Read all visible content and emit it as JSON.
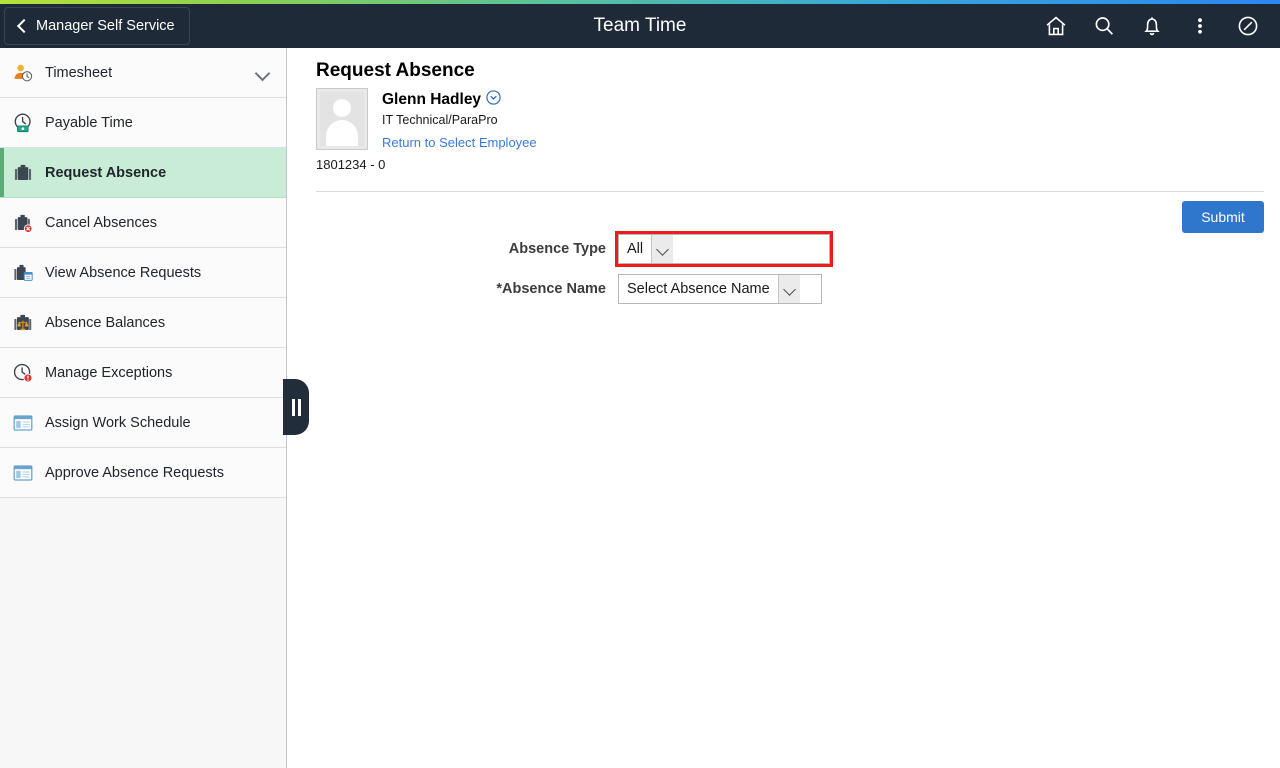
{
  "header": {
    "back_label": "Manager Self Service",
    "title": "Team Time",
    "icons": [
      {
        "name": "home-icon",
        "label": "Home"
      },
      {
        "name": "search-icon",
        "label": "Search"
      },
      {
        "name": "notifications-bell-icon",
        "label": "Notifications"
      },
      {
        "name": "actions-kebab-icon",
        "label": "Actions"
      },
      {
        "name": "navbar-compass-icon",
        "label": "NavBar"
      }
    ],
    "background_color": "#1f2a38",
    "accent_gradient_start": "#b6e23a",
    "accent_gradient_end": "#2e86f0"
  },
  "sidebar": {
    "selected_background": "#c9ecd6",
    "items": [
      {
        "label": "Timesheet",
        "icon": "person-clock-icon",
        "has_chevron": true,
        "selected": false
      },
      {
        "label": "Payable Time",
        "icon": "clock-money-icon",
        "has_chevron": false,
        "selected": false
      },
      {
        "label": "Request Absence",
        "icon": "briefcase-icon",
        "has_chevron": false,
        "selected": true
      },
      {
        "label": "Cancel Absences",
        "icon": "briefcase-cancel-icon",
        "has_chevron": false,
        "selected": false
      },
      {
        "label": "View Absence Requests",
        "icon": "briefcase-calendar-icon",
        "has_chevron": false,
        "selected": false
      },
      {
        "label": "Absence Balances",
        "icon": "briefcase-scale-icon",
        "has_chevron": false,
        "selected": false
      },
      {
        "label": "Manage Exceptions",
        "icon": "clock-alert-icon",
        "has_chevron": false,
        "selected": false
      },
      {
        "label": "Assign Work Schedule",
        "icon": "window-panel-icon",
        "has_chevron": false,
        "selected": false
      },
      {
        "label": "Approve Absence Requests",
        "icon": "window-panel-icon",
        "has_chevron": false,
        "selected": false
      }
    ],
    "collapse_handle": "collapse-sidebar-handle"
  },
  "main": {
    "page_title": "Request Absence",
    "employee": {
      "name": "Glenn Hadley",
      "job_title": "IT Technical/ParaPro",
      "return_link": "Return to Select Employee",
      "employee_id": "1801234 - 0",
      "related_actions_icon": "related-actions-chevron-icon"
    },
    "submit_label": "Submit",
    "submit_color": "#2f76cd",
    "form": {
      "absence_type": {
        "label": "Absence Type",
        "value": "All",
        "highlighted": true,
        "highlight_color": "#ee1c1c"
      },
      "absence_name": {
        "label": "*Absence Name",
        "value": "Select Absence Name",
        "highlighted": false
      }
    }
  }
}
